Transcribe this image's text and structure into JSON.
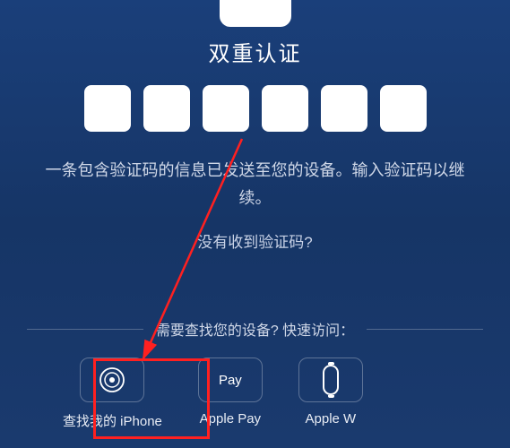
{
  "title": "双重认证",
  "message": "一条包含验证码的信息已发送至您的设备。输入验证码以继续。",
  "resend": "没有收到验证码?",
  "divider": "需要查找您的设备? 快速访问：",
  "apps": {
    "find": {
      "label": "查找我的 iPhone"
    },
    "pay": {
      "label": "Apple Pay",
      "iconText": "Pay"
    },
    "watch": {
      "label": "Apple W"
    }
  },
  "highlight_color": "#ff2020"
}
